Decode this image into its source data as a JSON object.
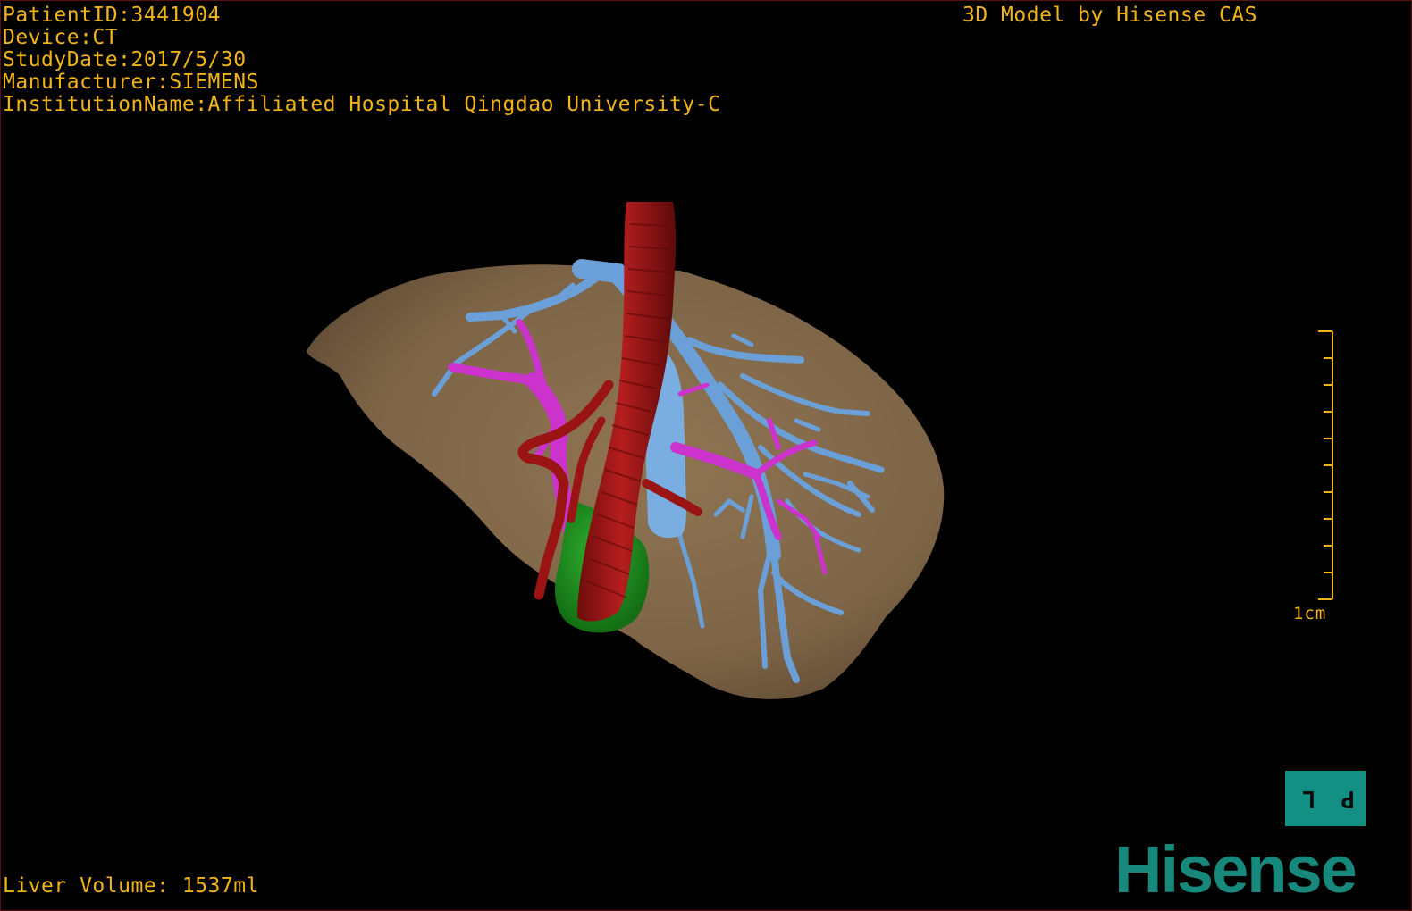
{
  "overlay": {
    "patient_id": "PatientID:3441904",
    "device": "Device:CT",
    "study_date": "StudyDate:2017/5/30",
    "manufacturer": "Manufacturer:SIEMENS",
    "institution": "InstitutionName:Affiliated Hospital Qingdao University-C",
    "model_credit": "3D Model by Hisense CAS",
    "liver_volume": "Liver Volume: 1537ml"
  },
  "scale_bar": {
    "label": "1cm",
    "ticks": 11
  },
  "orientation_cube": {
    "label": "P L"
  },
  "brand": {
    "logo_text": "Hisense"
  },
  "colors": {
    "overlay_text": "#f0b419",
    "liver": "#8b7150",
    "hepatic_vein": "#6b9fd8",
    "portal_vein": "#cc33cc",
    "ivc_artery": "#9a1414",
    "gallbladder": "#1f9a1f",
    "brand": "#17897c"
  }
}
